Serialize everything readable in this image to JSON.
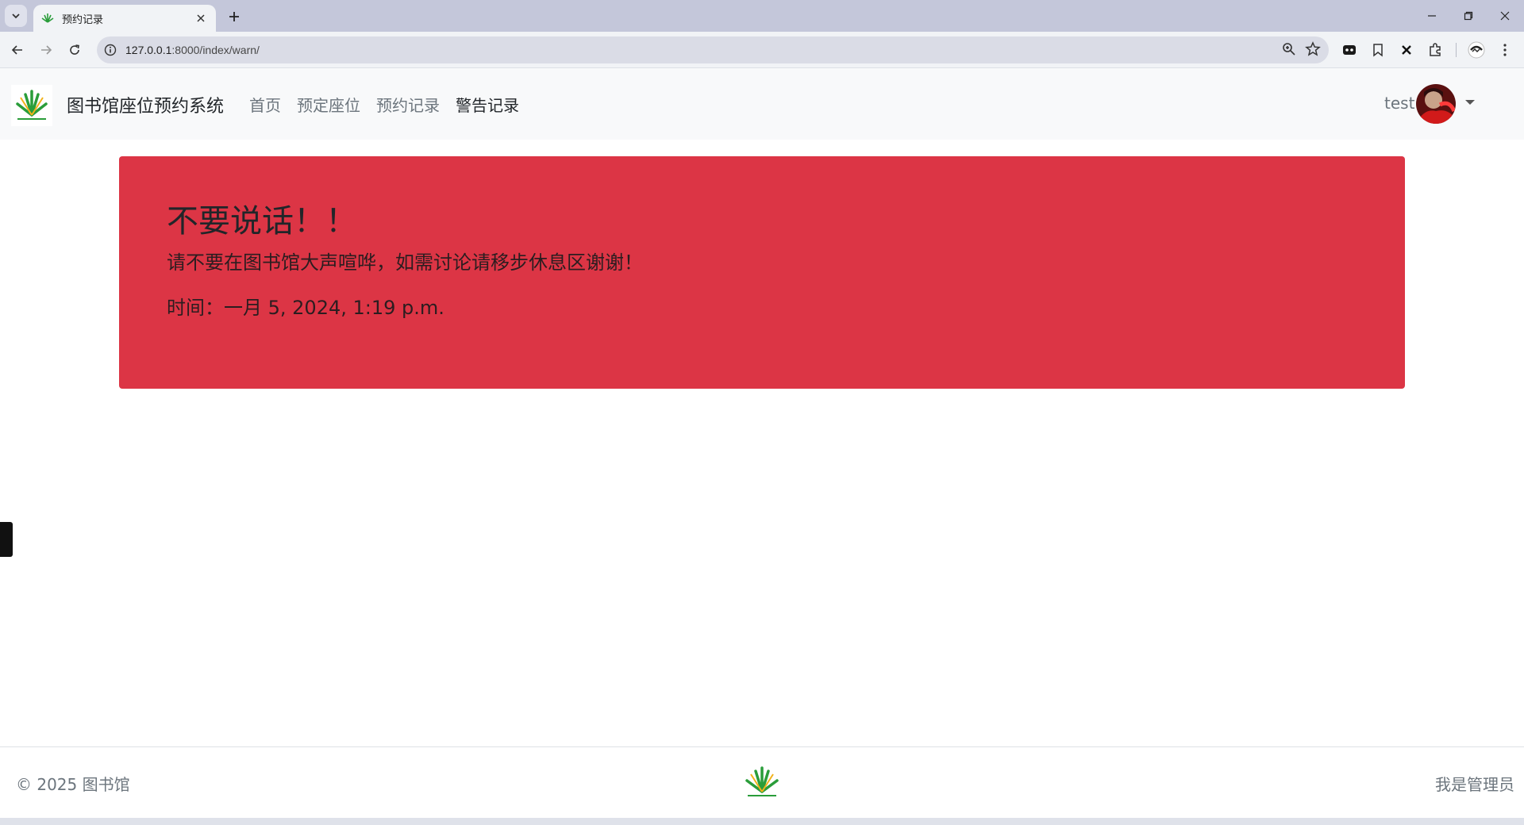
{
  "browser": {
    "tab_title": "预约记录",
    "url_host": "127.0.0.1",
    "url_path": ":8000/index/warn/"
  },
  "site": {
    "brand": "图书馆座位预约系统",
    "nav": [
      "首页",
      "预定座位",
      "预约记录",
      "警告记录"
    ],
    "active_nav": "警告记录",
    "user": "test"
  },
  "alert": {
    "title": "不要说话！！",
    "message": "请不要在图书馆大声喧哗，如需讨论请移步休息区谢谢！",
    "time": "时间：一月 5, 2024, 1:19 p.m.",
    "color": "#dc3545"
  },
  "footer": {
    "copyright": "© 2025 图书馆",
    "admin": "我是管理员"
  },
  "colors": {
    "tabstrip": "#c4c7da",
    "toolbar": "#f1f3f6",
    "navbar": "#f8f9fa",
    "logo_green": "#2a9d3a",
    "muted_text": "#6c757d"
  }
}
